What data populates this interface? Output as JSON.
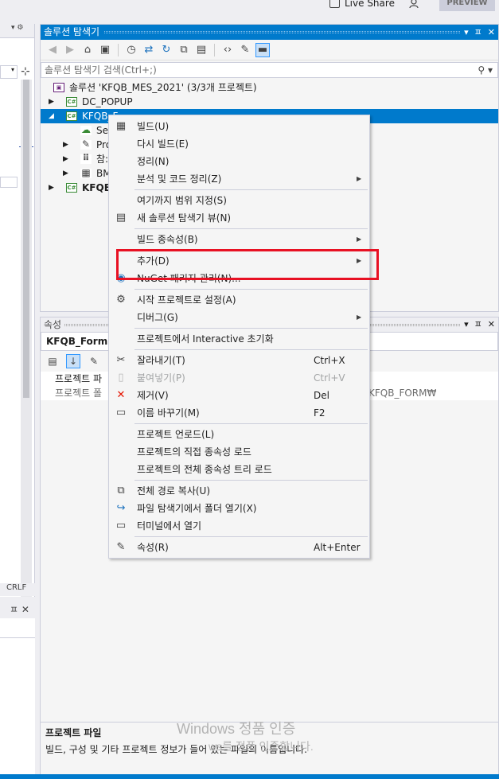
{
  "topbar": {
    "live_share": "Live Share",
    "preview": "PREVIEW"
  },
  "left_panel": {
    "status": "CRLF"
  },
  "solution_explorer": {
    "title": "솔루션 탐색기",
    "search_placeholder": "솔루션 탐색기 검색(Ctrl+;)",
    "tree": [
      {
        "label": "솔루션 'KFQB_MES_2021' (3/3개 프로젝트)",
        "icon": "solution-icon"
      },
      {
        "label": "DC_POPUP",
        "icon": "csharp-project-icon"
      },
      {
        "label": "KFQB_F",
        "icon": "csharp-project-icon",
        "selected": true
      },
      {
        "label": "Se",
        "icon": "connected-services-icon"
      },
      {
        "label": "Pro",
        "icon": "wrench-icon"
      },
      {
        "label": "참:",
        "icon": "references-icon"
      },
      {
        "label": "BM",
        "icon": "form-icon"
      },
      {
        "label": "KFQB_",
        "icon": "csharp-project-icon",
        "bold": true
      }
    ]
  },
  "properties": {
    "title": "속성",
    "object": "KFQB_Form 프",
    "rows": [
      {
        "label": "프로젝트 파",
        "value": ""
      },
      {
        "label": "프로젝트 폴",
        "value": "KFQB_FORM₩"
      }
    ],
    "desc_title": "프로젝트 파일",
    "desc_text": "빌드, 구성 및 기타 프로젝트 정보가 들어 있는 파일의 이름입니다."
  },
  "watermark": {
    "line1": "Windows 정품 인증",
    "line2": "ws를 정품 인증합니다."
  },
  "context_menu": {
    "items": [
      {
        "label": "빌드(U)",
        "icon": "build-icon"
      },
      {
        "label": "다시 빌드(E)"
      },
      {
        "label": "정리(N)"
      },
      {
        "label": "분석 및 코드 정리(Z)",
        "submenu": true
      },
      {
        "label": "여기까지 범위 지정(S)"
      },
      {
        "label": "새 솔루션 탐색기 뷰(N)",
        "icon": "new-view-icon"
      },
      {
        "label": "빌드 종속성(B)",
        "submenu": true
      },
      {
        "label": "추가(D)",
        "submenu": true
      },
      {
        "label": "NuGet 패키지 관리(N)...",
        "icon": "nuget-icon"
      },
      {
        "label": "시작 프로젝트로 설정(A)",
        "icon": "gear-icon"
      },
      {
        "label": "디버그(G)",
        "submenu": true
      },
      {
        "label": "프로젝트에서 Interactive 초기화"
      },
      {
        "label": "잘라내기(T)",
        "shortcut": "Ctrl+X",
        "icon": "scissors-icon"
      },
      {
        "label": "붙여넣기(P)",
        "shortcut": "Ctrl+V",
        "icon": "paste-icon",
        "disabled": true
      },
      {
        "label": "제거(V)",
        "shortcut": "Del",
        "icon": "delete-icon"
      },
      {
        "label": "이름 바꾸기(M)",
        "shortcut": "F2",
        "icon": "rename-icon"
      },
      {
        "label": "프로젝트 언로드(L)"
      },
      {
        "label": "프로젝트의 직접 종속성 로드"
      },
      {
        "label": "프로젝트의 전체 종속성 트리 로드"
      },
      {
        "label": "전체 경로 복사(U)",
        "icon": "copy-icon"
      },
      {
        "label": "파일 탐색기에서 폴더 열기(X)",
        "icon": "open-folder-arrow-icon"
      },
      {
        "label": "터미널에서 열기",
        "icon": "terminal-icon"
      },
      {
        "label": "속성(R)",
        "shortcut": "Alt+Enter",
        "icon": "wrench-icon"
      }
    ]
  },
  "colors": {
    "accent": "#007acc",
    "highlight_box": "#e81123"
  }
}
